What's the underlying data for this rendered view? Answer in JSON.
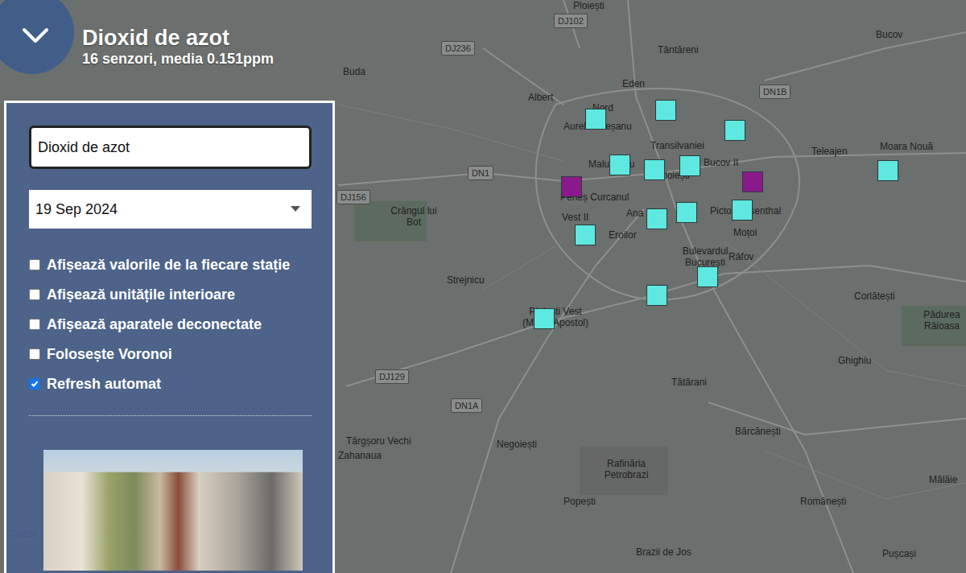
{
  "header": {
    "title": "Dioxid de azot",
    "subtitle": "16 senzori, media 0.151ppm"
  },
  "panel": {
    "pollutant": "Dioxid de azot",
    "date": "19 Sep 2024",
    "options": [
      {
        "label": "Afișează valorile de la fiecare stație",
        "checked": false
      },
      {
        "label": "Afișează unitățile interioare",
        "checked": false
      },
      {
        "label": "Afișează aparatele deconectate",
        "checked": false
      },
      {
        "label": "Folosește Voronoi",
        "checked": false
      },
      {
        "label": "Refresh automat",
        "checked": true
      }
    ]
  },
  "map": {
    "labels": [
      {
        "text": "Ploiești",
        "kind": "place"
      },
      {
        "text": "DJ102",
        "kind": "road"
      },
      {
        "text": "Tântăreni",
        "kind": "place"
      },
      {
        "text": "Bucov",
        "kind": "place"
      },
      {
        "text": "DJ236",
        "kind": "road"
      },
      {
        "text": "Buda",
        "kind": "place"
      },
      {
        "text": "Eden",
        "kind": "place"
      },
      {
        "text": "DN1B",
        "kind": "road"
      },
      {
        "text": "Albert",
        "kind": "place"
      },
      {
        "text": "Nord",
        "kind": "place"
      },
      {
        "text": "Aurel Mureșanu",
        "kind": "place"
      },
      {
        "text": "Transilvaniei",
        "kind": "place"
      },
      {
        "text": "Bucov II",
        "kind": "place"
      },
      {
        "text": "Teleajen",
        "kind": "place"
      },
      {
        "text": "Moara Nouă",
        "kind": "place"
      },
      {
        "text": "Malu Roșu",
        "kind": "place"
      },
      {
        "text": "Ploiești",
        "kind": "place"
      },
      {
        "text": "DN1",
        "kind": "road"
      },
      {
        "text": "DJ156",
        "kind": "road"
      },
      {
        "text": "Crângul lui Bot",
        "kind": "place"
      },
      {
        "text": "Peneș Curcanul",
        "kind": "place"
      },
      {
        "text": "Vest II",
        "kind": "place"
      },
      {
        "text": "Ana",
        "kind": "place"
      },
      {
        "text": "Pictor Rosenthal",
        "kind": "place"
      },
      {
        "text": "Eroilor",
        "kind": "place"
      },
      {
        "text": "Moțoi",
        "kind": "place"
      },
      {
        "text": "Bulevardul București",
        "kind": "place"
      },
      {
        "text": "Râfov",
        "kind": "place"
      },
      {
        "text": "Strejnicu",
        "kind": "place"
      },
      {
        "text": "Ploiești Vest (Mitica Apostol)",
        "kind": "place"
      },
      {
        "text": "Corlătești",
        "kind": "place"
      },
      {
        "text": "Pădurea Râioasa",
        "kind": "place"
      },
      {
        "text": "Ghighiu",
        "kind": "place"
      },
      {
        "text": "Tătărani",
        "kind": "place"
      },
      {
        "text": "DJ129",
        "kind": "road"
      },
      {
        "text": "DN1A",
        "kind": "road"
      },
      {
        "text": "Bărcănești",
        "kind": "place"
      },
      {
        "text": "Târgșoru Vechi",
        "kind": "place"
      },
      {
        "text": "Zahanaua",
        "kind": "place"
      },
      {
        "text": "Negoiești",
        "kind": "place"
      },
      {
        "text": "Rafinăria Petrobrazi",
        "kind": "place"
      },
      {
        "text": "Popești",
        "kind": "place"
      },
      {
        "text": "Românești",
        "kind": "place"
      },
      {
        "text": "Mălăie",
        "kind": "place"
      },
      {
        "text": "Brazii de Jos",
        "kind": "place"
      },
      {
        "text": "Pușcași",
        "kind": "place"
      },
      {
        "text": "Coada",
        "kind": "place"
      }
    ],
    "sensors": [
      {
        "color": "#5ee8e0"
      },
      {
        "color": "#5ee8e0"
      },
      {
        "color": "#5ee8e0"
      },
      {
        "color": "#5ee8e0"
      },
      {
        "color": "#5ee8e0"
      },
      {
        "color": "#5ee8e0"
      },
      {
        "color": "#8a1a8c"
      },
      {
        "color": "#5ee8e0"
      },
      {
        "color": "#8a1a8c"
      },
      {
        "color": "#5ee8e0"
      },
      {
        "color": "#5ee8e0"
      },
      {
        "color": "#5ee8e0"
      },
      {
        "color": "#5ee8e0"
      },
      {
        "color": "#5ee8e0"
      },
      {
        "color": "#5ee8e0"
      },
      {
        "color": "#5ee8e0"
      }
    ]
  }
}
